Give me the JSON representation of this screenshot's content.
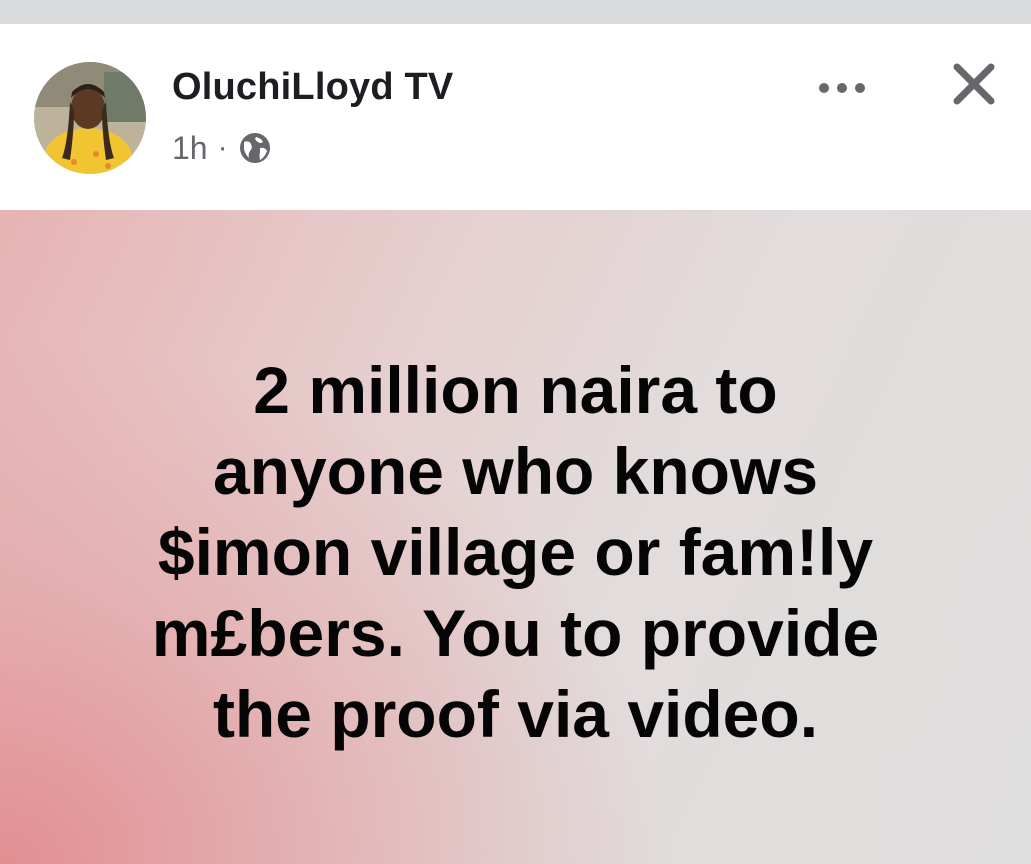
{
  "post": {
    "author": "OluchiLloyd TV",
    "time": "1h",
    "separator": "·",
    "audience_icon": "globe-icon",
    "text": "2 million naira to\nanyone who knows\n$imon village or fam!ly\nm£bers. You to  provide\nthe proof via video."
  },
  "icons": {
    "more": "more-options-icon",
    "close": "close-icon"
  },
  "colors": {
    "name": "#1c1e21",
    "meta": "#65676b",
    "background_pink": "#e28c8f",
    "background_gray": "#dfdede"
  }
}
